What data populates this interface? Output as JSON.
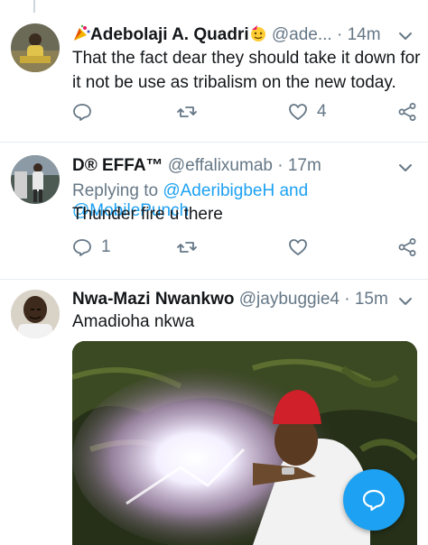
{
  "tweets": [
    {
      "name": "Adebolaji A. Quadri",
      "handle": "@ade...",
      "dot": "·",
      "time": "14m",
      "text": "That the fact dear they should take it down for it not be use as tribalism on the new today.",
      "reply_count": "",
      "like_count": "4"
    },
    {
      "name": "D® EFFA™",
      "handle": "@effalixumab",
      "dot": "·",
      "time": "17m",
      "replying_prefix": "Replying to",
      "replying_user1": "@AderibigbeH",
      "replying_and": "and",
      "replying_user2": "@MobilePunch",
      "text": "Thunder fire u there",
      "reply_count": "1",
      "like_count": ""
    },
    {
      "name": "Nwa-Mazi Nwankwo",
      "handle": "@jaybuggie4",
      "dot": "·",
      "time": "15m",
      "text": "Amadioha nkwa"
    }
  ],
  "colors": {
    "accent": "#1da1f2",
    "secondary_text": "#657786",
    "divider": "#e6ecf0"
  },
  "icons": [
    "reply-icon",
    "retweet-icon",
    "like-icon",
    "share-icon",
    "chevron-down-icon",
    "compose-reply-icon",
    "party-emoji-icon"
  ]
}
